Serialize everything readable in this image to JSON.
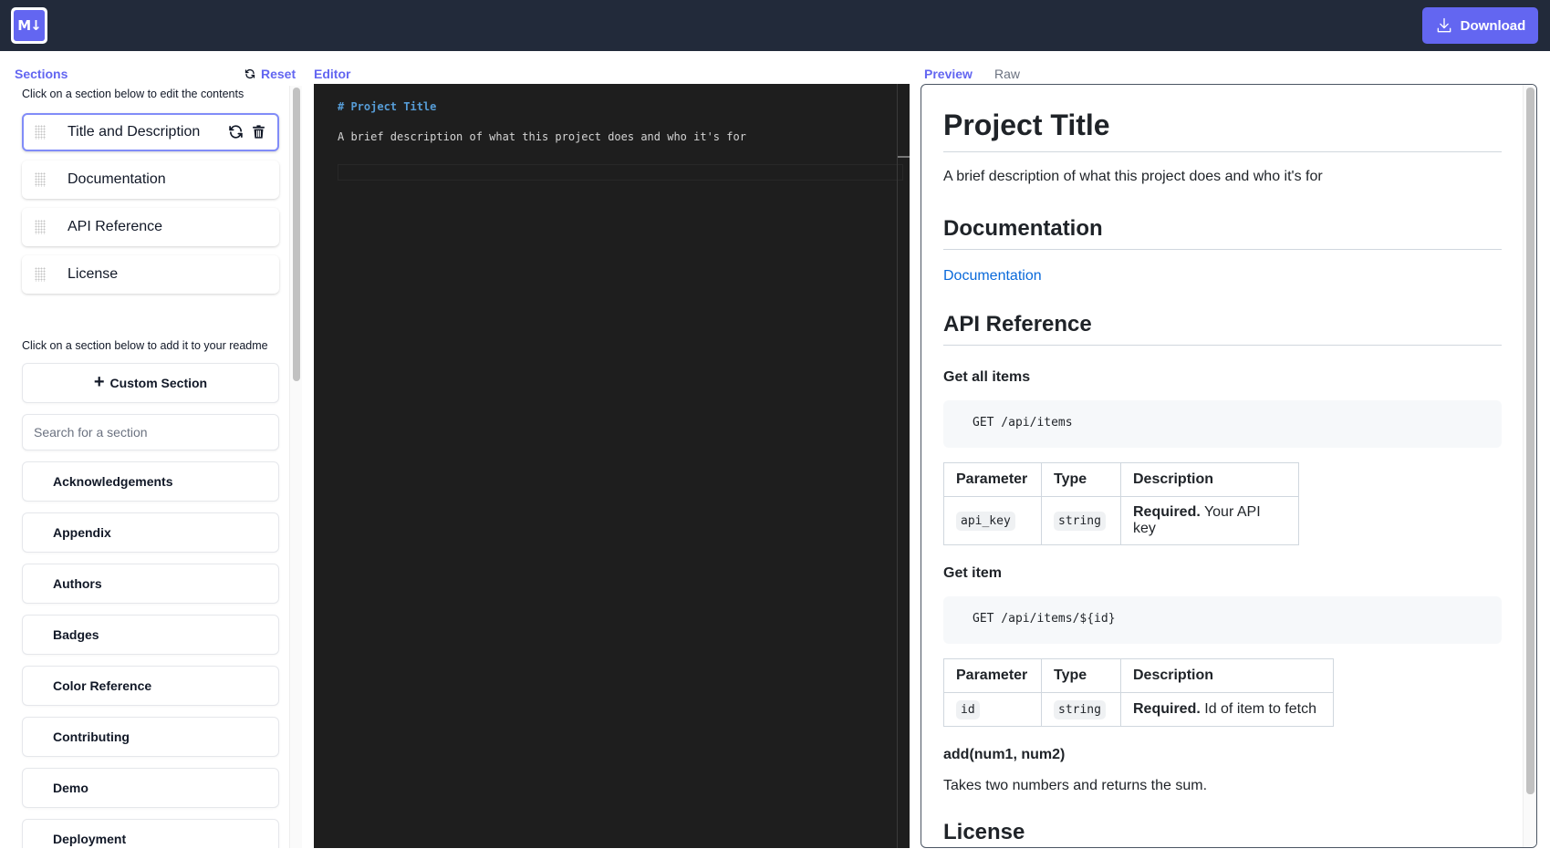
{
  "header": {
    "logo_text": "M↓",
    "download_label": "Download"
  },
  "sidebar": {
    "title": "Sections",
    "reset_label": "Reset",
    "edit_hint": "Click on a section below to edit the contents",
    "selected_sections": [
      {
        "label": "Title and Description",
        "active": true
      },
      {
        "label": "Documentation"
      },
      {
        "label": "API Reference"
      },
      {
        "label": "License"
      }
    ],
    "add_hint": "Click on a section below to add it to your readme",
    "custom_section_label": "Custom Section",
    "search_placeholder": "Search for a section",
    "search_value": "",
    "templates": [
      "Acknowledgements",
      "Appendix",
      "Authors",
      "Badges",
      "Color Reference",
      "Contributing",
      "Demo",
      "Deployment"
    ]
  },
  "editor": {
    "title": "Editor",
    "lines": [
      "# Project Title",
      "A brief description of what this project does and who it's for"
    ]
  },
  "preview": {
    "tabs": [
      {
        "label": "Preview",
        "active": true
      },
      {
        "label": "Raw",
        "active": false
      }
    ],
    "h1": "Project Title",
    "description": "A brief description of what this project does and who it's for",
    "documentation": {
      "heading": "Documentation",
      "link_text": "Documentation"
    },
    "api": {
      "heading": "API Reference",
      "endpoints": [
        {
          "title": "Get all items",
          "code": "GET /api/items",
          "headers": [
            "Parameter",
            "Type",
            "Description"
          ],
          "row": {
            "param": "api_key",
            "type": "string",
            "required": "Required.",
            "desc": " Your API key"
          }
        },
        {
          "title": "Get item",
          "code": "GET /api/items/${id}",
          "headers": [
            "Parameter",
            "Type",
            "Description"
          ],
          "row": {
            "param": "id",
            "type": "string",
            "required": "Required.",
            "desc": " Id of item to fetch"
          }
        }
      ],
      "function_title": "add(num1, num2)",
      "function_desc": "Takes two numbers and returns the sum."
    },
    "license": {
      "heading": "License"
    }
  },
  "colors": {
    "accent": "#6366f1",
    "header_bg": "#222a3a",
    "editor_bg": "#1e1e1e",
    "link": "#0969da"
  }
}
